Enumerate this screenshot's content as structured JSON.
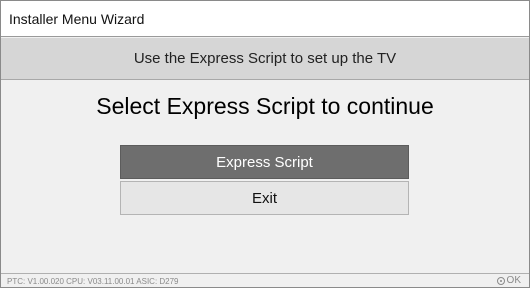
{
  "window": {
    "title": "Installer Menu Wizard"
  },
  "subtitle": "Use the Express Script to set up the TV",
  "heading": "Select Express Script to continue",
  "buttons": {
    "express_script": "Express Script",
    "exit": "Exit"
  },
  "footer": {
    "version_info": "PTC:  V1.00.020 CPU: V03.11.00.01 ASIC: D279",
    "ok_icon": "ok-button-icon",
    "ok_label": "OK"
  },
  "colors": {
    "selected_button": "#6e6e6e",
    "unselected_button": "#e6e6e6",
    "subtitle_bar": "#d6d6d6"
  }
}
